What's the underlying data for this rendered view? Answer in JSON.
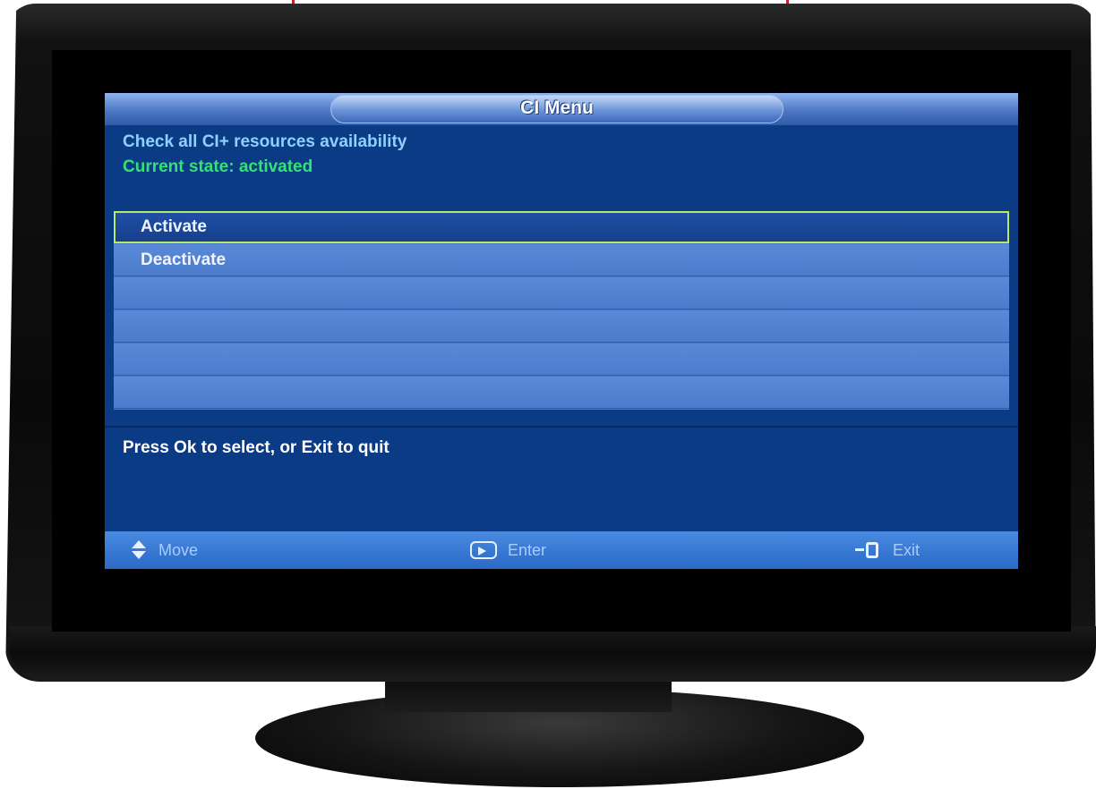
{
  "menu": {
    "title": "CI Menu",
    "description": "Check all CI+ resources availability",
    "state": "Current state: activated",
    "options": [
      "Activate",
      "Deactivate",
      "",
      "",
      "",
      ""
    ],
    "selected_index": 0,
    "help": "Press Ok to select, or Exit to quit"
  },
  "footer": {
    "move_label": "Move",
    "enter_label": "Enter",
    "exit_label": "Exit",
    "move_icon": "up-down-arrows-icon",
    "enter_icon": "enter-icon",
    "exit_icon": "exit-door-icon"
  },
  "colors": {
    "panel_bg": "#0c3b86",
    "list_bg": "#4978c9",
    "selection_border": "#b8e96a",
    "description_text": "#8fd0ff",
    "state_text": "#34e07a",
    "footer_bg": "#3576d2"
  }
}
